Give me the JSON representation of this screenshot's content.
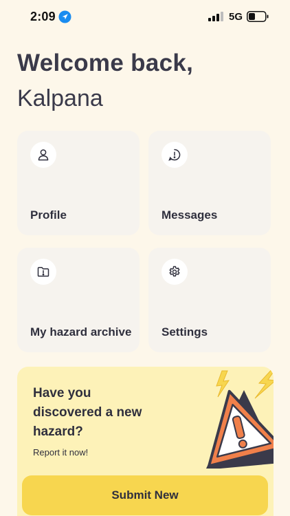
{
  "status_bar": {
    "time": "2:09",
    "network": "5G",
    "location_icon": "location-arrow-icon",
    "signal_icon": "cellular-signal-icon",
    "battery_icon": "battery-icon"
  },
  "greeting": {
    "title": "Welcome back,",
    "name": "Kalpana"
  },
  "tiles": [
    {
      "label": "Profile",
      "icon": "user-icon"
    },
    {
      "label": "Messages",
      "icon": "alert-circle-icon"
    },
    {
      "label": "My hazard archive",
      "icon": "folder-alert-icon"
    },
    {
      "label": "Settings",
      "icon": "gear-icon"
    }
  ],
  "hazard_card": {
    "heading": "Have you discovered a new hazard?",
    "subtext": "Report it now!",
    "button_label": "Submit New",
    "illustration": "warning-triangle-icon"
  },
  "colors": {
    "background": "#fdf7ea",
    "tile_background": "#f6f3ee",
    "card_background": "#fdf2b8",
    "button": "#f7d64f",
    "warning_orange": "#f0804a",
    "lightning_yellow": "#f7d64f",
    "text": "#2f2f3d",
    "location_blue": "#1a8cf0"
  }
}
